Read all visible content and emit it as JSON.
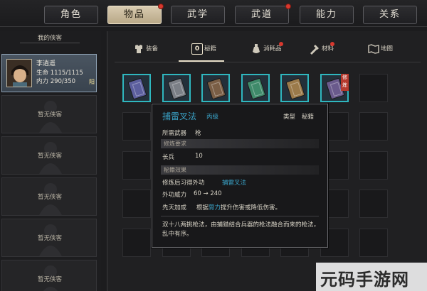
{
  "tabs": [
    {
      "label": "角色",
      "active": false,
      "dot": false
    },
    {
      "label": "物品",
      "active": true,
      "dot": true
    },
    {
      "label": "武学",
      "active": false,
      "dot": false
    },
    {
      "label": "武道",
      "active": false,
      "dot": true
    },
    {
      "label": "能力",
      "active": false,
      "dot": false
    },
    {
      "label": "关系",
      "active": false,
      "dot": false
    }
  ],
  "sidebar": {
    "title": "我的侠客",
    "selected": {
      "name": "李逍遥",
      "hp": "生命 1115/1115",
      "mp": "内力 290/350",
      "tag": "阳"
    },
    "empty_label": "暂无侠客"
  },
  "categories": [
    {
      "label": "装备",
      "icon": "armor-icon"
    },
    {
      "label": "秘籍",
      "icon": "book-icon",
      "active": true
    },
    {
      "label": "消耗品",
      "icon": "potion-icon",
      "dot": true
    },
    {
      "label": "材料",
      "icon": "material-icon",
      "dot": true
    },
    {
      "label": "地图",
      "icon": "map-icon"
    }
  ],
  "items": [
    {
      "color": "#5c5f9e"
    },
    {
      "color": "#7b7f86"
    },
    {
      "color": "#7a5e45"
    },
    {
      "color": "#3f8a6a"
    },
    {
      "color": "#9b7a4a"
    },
    {
      "color": "#6a5a8c",
      "badge": "修炼"
    }
  ],
  "tooltip": {
    "title": "捕雷叉法",
    "grade": "丙级",
    "type_label": "类型",
    "type_value": "秘籍",
    "weapon_label": "所需武器",
    "weapon_value": "枪",
    "req_header": "修炼要求",
    "req_label": "长兵",
    "req_value": "10",
    "effect_header": "秘籍效果",
    "skill_label": "修炼后习得外功",
    "skill_value": "捕雷叉法",
    "power_label": "外功威力",
    "power_value": "60 → 240",
    "innate_label": "先天加成",
    "innate_value_pre": "根据",
    "innate_value_link": "膂力",
    "innate_value_post": "提升伤害或降低伤害。",
    "desc": "双十八两挑枪法，由捕猎结合兵器的枪法融合而来的枪法，乱中有序。"
  },
  "watermark": "元码手游网"
}
